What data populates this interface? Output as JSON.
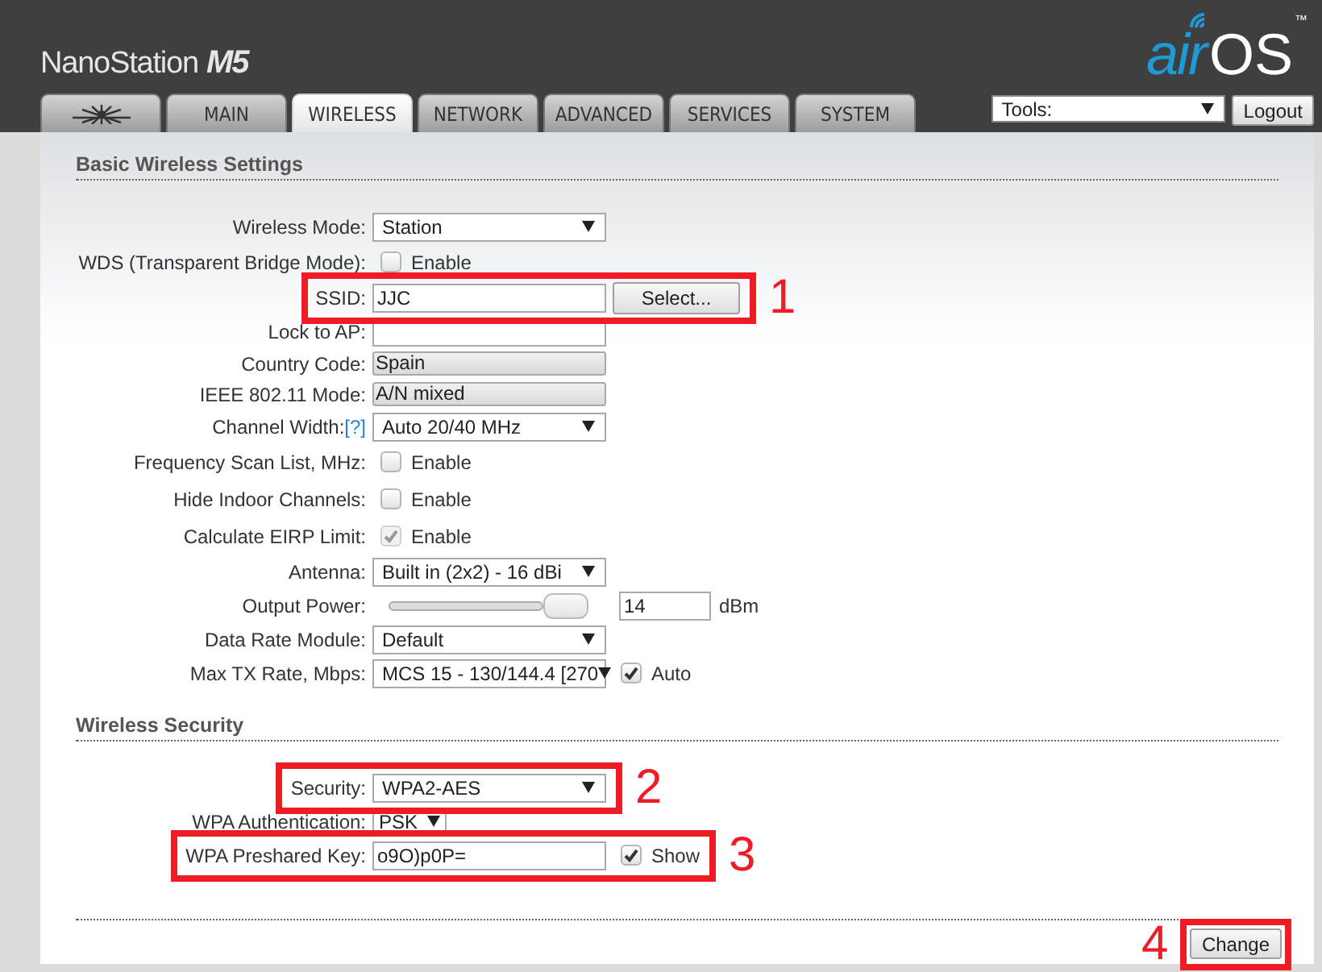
{
  "header": {
    "product": "NanoStation",
    "model": "M5",
    "logo_air": "air",
    "logo_os": "OS",
    "trademark": "™"
  },
  "tabs": [
    {
      "kind": "icon",
      "selected": false
    },
    {
      "kind": "text",
      "label": "MAIN",
      "selected": false
    },
    {
      "kind": "text",
      "label": "WIRELESS",
      "selected": true
    },
    {
      "kind": "text",
      "label": "NETWORK",
      "selected": false
    },
    {
      "kind": "text",
      "label": "ADVANCED",
      "selected": false
    },
    {
      "kind": "text",
      "label": "SERVICES",
      "selected": false
    },
    {
      "kind": "text",
      "label": "SYSTEM",
      "selected": false
    }
  ],
  "tools": {
    "value": "Tools:"
  },
  "logout": "Logout",
  "sections": [
    {
      "title": "Basic Wireless Settings",
      "rows": [
        {
          "kind": "select",
          "label": "Wireless Mode:",
          "value": "Station"
        },
        {
          "kind": "checkbox",
          "label": "WDS (Transparent Bridge Mode):",
          "checked": false,
          "disabled": false,
          "text": "Enable"
        },
        {
          "kind": "text",
          "label": "SSID:",
          "value": "JJC",
          "button": "Select...",
          "callout": "1"
        },
        {
          "kind": "text",
          "label": "Lock to AP:"
        },
        {
          "kind": "readonly",
          "label": "Country Code:",
          "value": "Spain"
        },
        {
          "kind": "readonly",
          "label": "IEEE 802.11 Mode:",
          "value": "A/N mixed"
        },
        {
          "kind": "select",
          "label": "Channel Width:",
          "help": "[?]",
          "value": "Auto 20/40 MHz"
        },
        {
          "kind": "checkbox",
          "label": "Frequency Scan List, MHz:",
          "checked": false,
          "disabled": false,
          "text": "Enable"
        },
        {
          "kind": "checkbox",
          "label": "Hide Indoor Channels:",
          "checked": false,
          "disabled": false,
          "text": "Enable"
        },
        {
          "kind": "checkbox",
          "label": "Calculate EIRP Limit:",
          "checked": true,
          "disabled": true,
          "text": "Enable"
        },
        {
          "kind": "select",
          "label": "Antenna:",
          "value": "Built in (2x2) - 16 dBi"
        },
        {
          "kind": "slider",
          "label": "Output Power:",
          "level": 0.9,
          "value": "14",
          "unit": "dBm"
        },
        {
          "kind": "select",
          "label": "Data Rate Module:",
          "value": "Default"
        },
        {
          "kind": "select",
          "label": "Max TX Rate, Mbps:",
          "value": "MCS 15 - 130/144.4 [270",
          "checkbox": {
            "checked": true,
            "text": "Auto"
          }
        }
      ]
    },
    {
      "title": "Wireless Security",
      "rows": [
        {
          "kind": "select",
          "label": "Security:",
          "value": "WPA2-AES",
          "callout": "2"
        },
        {
          "kind": "compact_select",
          "label": "WPA Authentication:",
          "value": "PSK"
        },
        {
          "kind": "text",
          "label": "WPA Preshared Key:",
          "value": "o9O)p0P=",
          "checkbox": {
            "checked": true,
            "text": "Show"
          },
          "callout": "3"
        }
      ]
    }
  ],
  "submit": {
    "label": "Change",
    "callout": "4"
  }
}
